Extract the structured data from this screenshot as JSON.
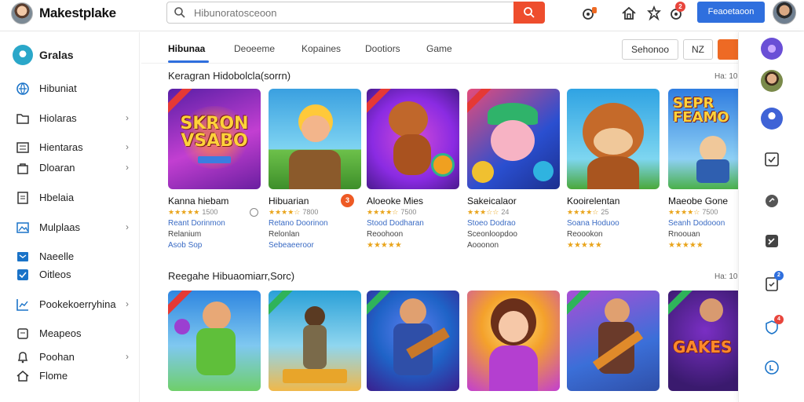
{
  "app": {
    "title": "Makestplake"
  },
  "search": {
    "placeholder": "Hibunoratosceoon"
  },
  "header": {
    "primary_button": "Feaoetaoon",
    "badge_count": "2"
  },
  "sidebar": {
    "profile_name": "Gralas",
    "items": [
      {
        "label": "Hibuniat",
        "icon": "globe-icon",
        "chevron": false
      },
      {
        "label": "Hiolaras",
        "icon": "folder-icon",
        "chevron": true
      },
      {
        "label": "Hientaras",
        "icon": "list-icon",
        "chevron": true
      },
      {
        "label": "Dloaran",
        "icon": "bag-icon",
        "chevron": true
      },
      {
        "label": "Hbelaia",
        "icon": "document-icon",
        "chevron": false
      },
      {
        "label": "Mulplaas",
        "icon": "image-icon",
        "chevron": true
      },
      {
        "label": "Naeelle",
        "icon": "mail-icon",
        "chevron": false
      },
      {
        "label": "Oitleos",
        "icon": "check-icon",
        "chevron": false
      },
      {
        "label": "Pookekoerryhina",
        "icon": "chart-icon",
        "chevron": true
      },
      {
        "label": "Meapeos",
        "icon": "copy-icon",
        "chevron": false
      },
      {
        "label": "Poohan",
        "icon": "bell-icon",
        "chevron": true
      },
      {
        "label": "Flome",
        "icon": "home-icon",
        "chevron": false
      }
    ]
  },
  "tabs": [
    {
      "label": "Hibunaa",
      "active": true
    },
    {
      "label": "Deoeeme",
      "active": false
    },
    {
      "label": "Kopaines",
      "active": false
    },
    {
      "label": "Dootiors",
      "active": false
    },
    {
      "label": "Game",
      "active": false
    }
  ],
  "toolbar": {
    "filter_label": "Sehonoo",
    "nz_label": "NZ"
  },
  "sections": [
    {
      "title": "Keragran Hidobolcla(sorrn)",
      "more": "Ha: 10",
      "cards": [
        {
          "title": "Kanna hiebam",
          "rating_stars": "★★★★★",
          "rating_num": "1500",
          "developer": "Reant Dorinmon",
          "category": "Relanium",
          "price": "Asob Sop",
          "thumb_text": "SKRON VSABO",
          "colors": [
            "#5a1fa6",
            "#c23fd1"
          ]
        },
        {
          "title": "Hibuarian",
          "rating_stars": "★★★★☆",
          "rating_num": "7800",
          "developer": "Retano Doorinon",
          "category": "Relonlan",
          "price": "Sebeaeeroor",
          "badge": "3",
          "colors": [
            "#3aa0e0",
            "#7fd4f2"
          ]
        },
        {
          "title": "Aloeoke Mies",
          "rating_stars": "★★★★☆",
          "rating_num": "7500",
          "developer": "Stood Dodharan",
          "category": "Reoohoon",
          "price": "★★★★★",
          "colors": [
            "#8a2be2",
            "#d24bd8"
          ]
        },
        {
          "title": "Sakeicalaor",
          "rating_stars": "★★★☆☆",
          "rating_num": "24",
          "developer": "Stoeo Dodrao",
          "category": "Sceonloopdoo",
          "price": "Aooonon",
          "colors": [
            "#2a4fd0",
            "#e54c7a"
          ]
        },
        {
          "title": "Kooirelentan",
          "rating_stars": "★★★★☆",
          "rating_num": "25",
          "developer": "Soana Hoduoo",
          "category": "Reoookon",
          "price": "★★★★★",
          "colors": [
            "#2fa3e3",
            "#7ed6f0"
          ]
        },
        {
          "title": "Maeobe Gone",
          "rating_stars": "★★★★☆",
          "rating_num": "7500",
          "developer": "Seanh Dodooon",
          "category": "Rnoouan",
          "price": "★★★★★",
          "thumb_text": "SEPR FEAMO",
          "colors": [
            "#2f7de0",
            "#8ed0f5"
          ]
        }
      ]
    },
    {
      "title": "Reegahe Hibuaomiarr,Sorc)",
      "more": "Ha: 10",
      "cards": [
        {
          "colors": [
            "#2f86e0",
            "#6fcf6a"
          ]
        },
        {
          "colors": [
            "#2aa0d8",
            "#f0b84a"
          ]
        },
        {
          "colors": [
            "#1f63c7",
            "#5e2fb0"
          ]
        },
        {
          "colors": [
            "#f4a12b",
            "#c23fd1"
          ]
        },
        {
          "colors": [
            "#3b6fd8",
            "#a84fd6"
          ]
        },
        {
          "thumb_text": "GAKES",
          "colors": [
            "#3a1a6e",
            "#7a2fc4"
          ]
        }
      ]
    }
  ],
  "right_rail": [
    {
      "type": "avatar",
      "icon": "music-avatar-icon",
      "color": "#6a4fd6"
    },
    {
      "type": "avatar",
      "icon": "user-avatar-icon",
      "color": "#7a8a4a"
    },
    {
      "type": "avatar",
      "icon": "person-icon",
      "color": "#3f63d6"
    },
    {
      "type": "icon",
      "icon": "checkbox-icon"
    },
    {
      "type": "icon",
      "icon": "chat-icon"
    },
    {
      "type": "icon",
      "icon": "edit-icon"
    },
    {
      "type": "icon",
      "icon": "clipboard-icon",
      "badge": "2",
      "badge_color": "#2f6fde"
    },
    {
      "type": "icon",
      "icon": "shield-icon",
      "badge": "4",
      "badge_color": "#e8453c"
    },
    {
      "type": "icon",
      "icon": "info-icon"
    }
  ],
  "colors": {
    "accent": "#2f6fde",
    "brand": "#ee4d2d",
    "badge": "#e8453c",
    "star": "#e9a41b"
  }
}
